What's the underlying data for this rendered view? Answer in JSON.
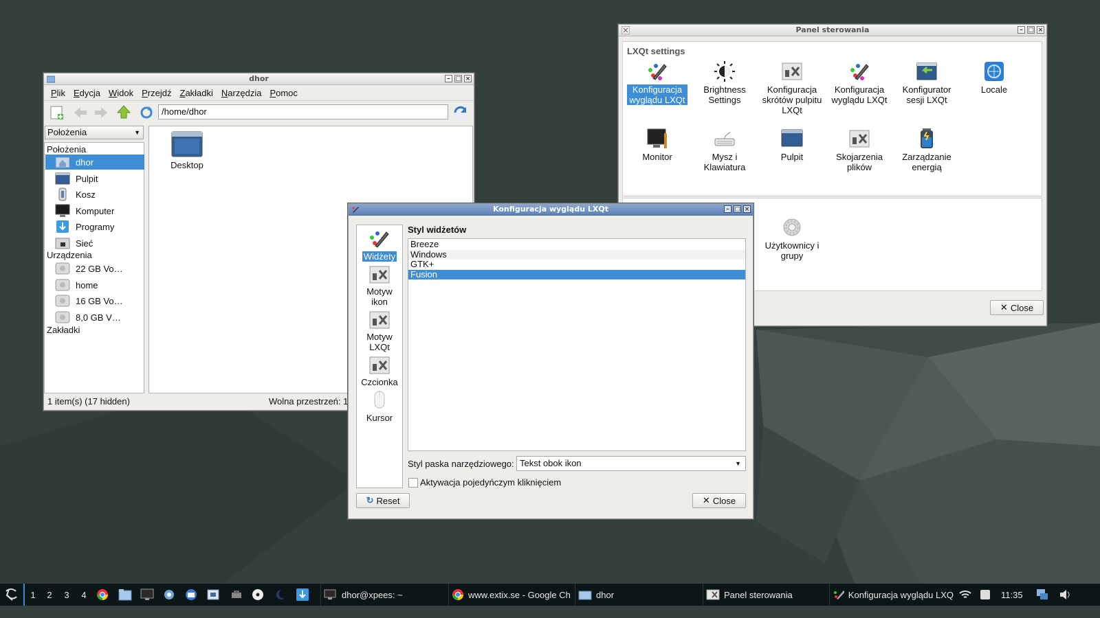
{
  "colors": {
    "desktop": "#33403e",
    "selection": "#3d8ed6",
    "taskbar": "#0c1617"
  },
  "file_manager": {
    "title": "dhor",
    "menu": [
      "Plik",
      "Edycja",
      "Widok",
      "Przejdź",
      "Zakładki",
      "Narzędzia",
      "Pomoc"
    ],
    "path": "/home/dhor",
    "side_combo": "Położenia",
    "places_header": "Położenia",
    "places": [
      "dhor",
      "Pulpit",
      "Kosz",
      "Komputer",
      "Programy",
      "Sieć"
    ],
    "devices_header": "Urządzenia",
    "devices": [
      "22 GB Vo…",
      "home",
      "16 GB Vo…",
      "8,0 GB V…"
    ],
    "bookmarks_header": "Zakładki",
    "files": [
      "Desktop"
    ],
    "status_left": "1 item(s) (17 hidden)",
    "status_right": "Wolna przestrzeń: 13"
  },
  "control_panel": {
    "title": "Panel sterowania",
    "section1": "LXQt settings",
    "items": [
      {
        "label": "Konfiguracja wyglądu LXQt",
        "icon": "brush-icon"
      },
      {
        "label": "Brightness Settings",
        "icon": "brightness-icon"
      },
      {
        "label": "Konfiguracja skrótów pulpitu LXQt",
        "icon": "tools-icon"
      },
      {
        "label": "Konfiguracja wyglądu LXQt",
        "icon": "brush-icon"
      },
      {
        "label": "Konfigurator sesji LXQt",
        "icon": "session-icon"
      },
      {
        "label": "Locale",
        "icon": "globe-icon"
      },
      {
        "label": "Monitor",
        "icon": "monitor-icon"
      },
      {
        "label": "Mysz i Klawiatura",
        "icon": "keyboard-icon"
      },
      {
        "label": "Pulpit",
        "icon": "desktop-icon"
      },
      {
        "label": "Skojarzenia plików",
        "icon": "tools-icon"
      },
      {
        "label": "Zarządzanie energią",
        "icon": "battery-icon"
      }
    ],
    "section2_items": [
      {
        "label": "Użytkownicy i grupy",
        "icon": "gear-icon"
      }
    ],
    "close": "Close"
  },
  "appearance": {
    "title": "Konfiguracja wyglądu LXQt",
    "sidebar": [
      "Widżety",
      "Motyw ikon",
      "Motyw LXQt",
      "Czcionka",
      "Kursor"
    ],
    "heading": "Styl widżetów",
    "styles": [
      "Breeze",
      "Windows",
      "GTK+",
      "Fusion"
    ],
    "selected_style": "Fusion",
    "toolbar_label": "Styl paska narzędziowego:",
    "toolbar_value": "Tekst obok ikon",
    "checkbox_label": "Aktywacja pojedyńczym kliknięciem",
    "reset": "Reset",
    "close": "Close"
  },
  "taskbar": {
    "workspaces": [
      "1",
      "2",
      "3",
      "4"
    ],
    "tasks": [
      "dhor@xpees: ~",
      "www.extix.se - Google Ch",
      "dhor",
      "Panel sterowania",
      "Konfiguracja wyglądu LXQ"
    ],
    "clock": "11:35"
  }
}
